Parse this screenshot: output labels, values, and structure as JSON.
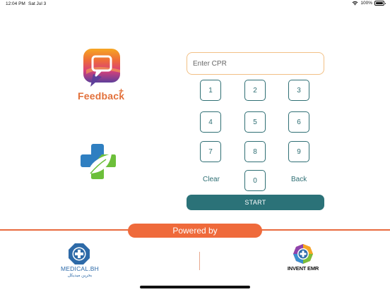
{
  "status_bar": {
    "time": "12:04 PM",
    "date": "Sat Jul 3",
    "battery": "100%",
    "icons": [
      "wifi-icon",
      "battery-icon"
    ]
  },
  "feedback_logo": {
    "text": "Feedback",
    "superscript": "+"
  },
  "cpr": {
    "placeholder": "Enter CPR",
    "value": ""
  },
  "keypad": {
    "keys": [
      "1",
      "2",
      "3",
      "4",
      "5",
      "6",
      "7",
      "8",
      "9",
      "0"
    ],
    "clear_label": "Clear",
    "back_label": "Back"
  },
  "start_label": "START",
  "powered_by": "Powered by",
  "medical_logo": {
    "text": "MEDICAL.BH",
    "arabic": "بحرين ميديكل"
  },
  "invent_logo": {
    "text": "INVENT EMR"
  },
  "colors": {
    "teal": "#2b7278",
    "orange": "#ef6a3b",
    "input_border": "#f2c085"
  }
}
